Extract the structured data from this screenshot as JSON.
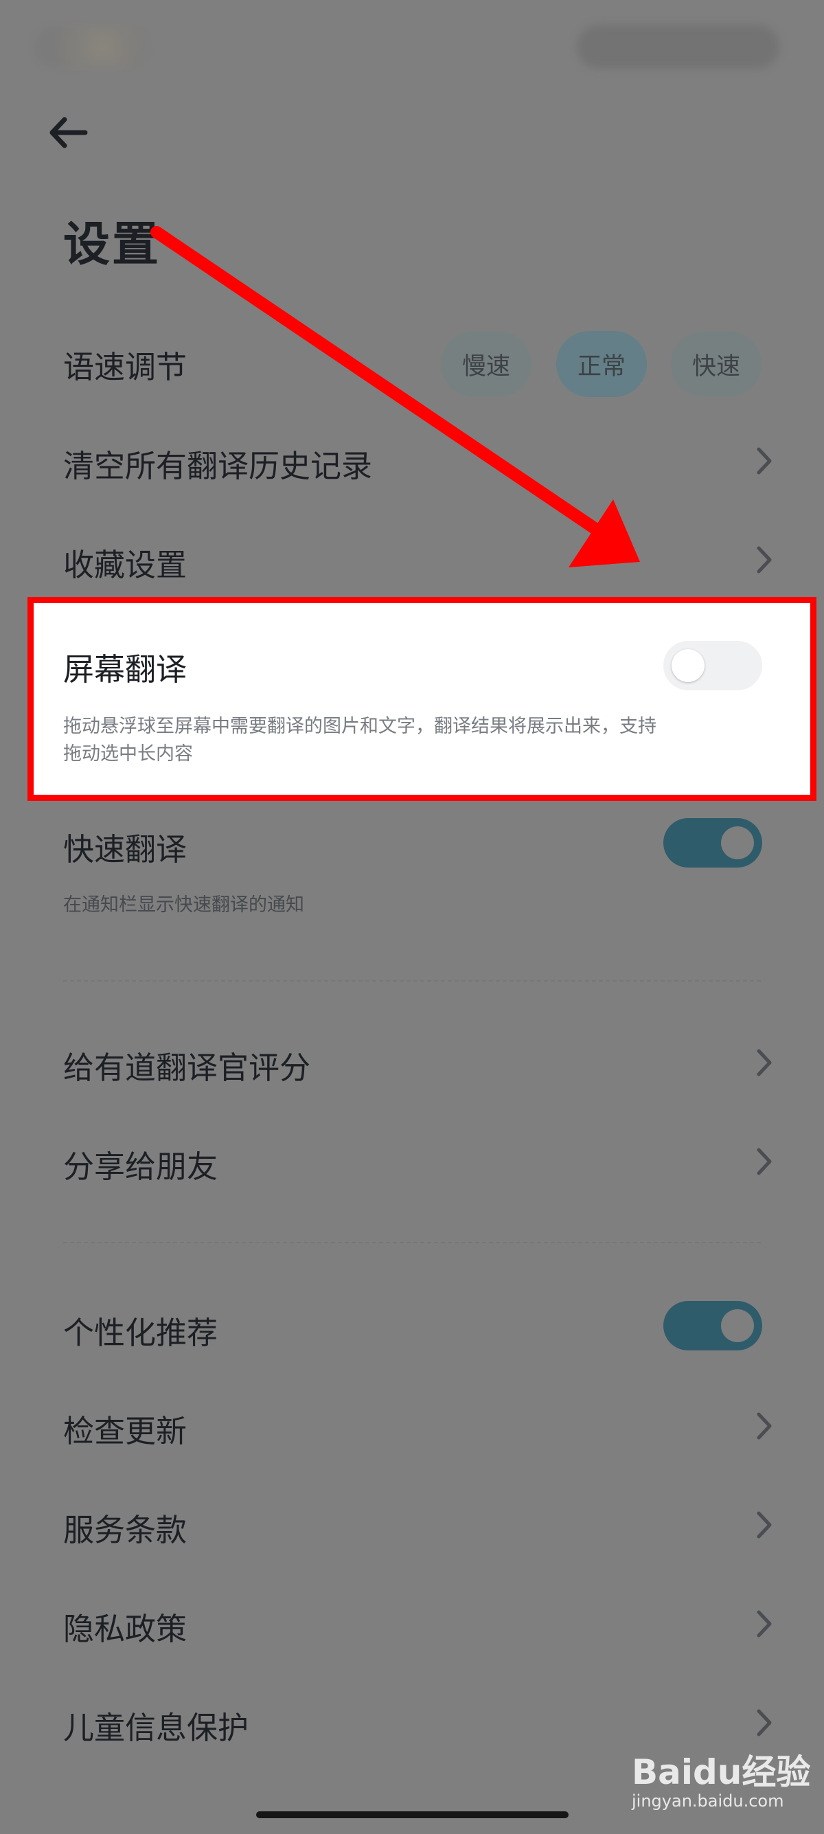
{
  "header": {
    "title": "设置"
  },
  "settings": {
    "speech_speed": {
      "label": "语速调节",
      "options": [
        "慢速",
        "正常",
        "快速"
      ],
      "selected": "正常"
    },
    "clear_history": {
      "label": "清空所有翻译历史记录"
    },
    "favorites": {
      "label": "收藏设置"
    },
    "screen_translate": {
      "label": "屏幕翻译",
      "description": "拖动悬浮球至屏幕中需要翻译的图片和文字，翻译结果将展示出来，支持拖动选中长内容",
      "enabled": false
    },
    "quick_translate": {
      "label": "快速翻译",
      "description": "在通知栏显示快速翻译的通知",
      "enabled": true
    },
    "rate_app": {
      "label": "给有道翻译官评分"
    },
    "share": {
      "label": "分享给朋友"
    },
    "personalized": {
      "label": "个性化推荐",
      "enabled": true
    },
    "check_update": {
      "label": "检查更新"
    },
    "terms": {
      "label": "服务条款"
    },
    "privacy": {
      "label": "隐私政策"
    },
    "child_protection": {
      "label": "儿童信息保护"
    }
  },
  "annotation": {
    "color": "#ff0000"
  },
  "colors": {
    "overlay": "#7f7f7f",
    "toggle_on": "#2f5c6b",
    "highlight_border": "#ff0000"
  },
  "watermark": {
    "logo": "Baidu经验",
    "url": "jingyan.baidu.com"
  }
}
